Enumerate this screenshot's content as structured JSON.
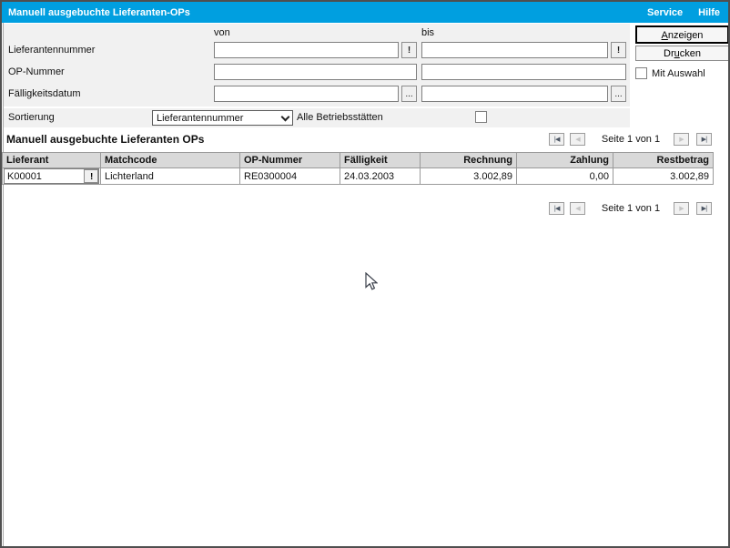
{
  "colors": {
    "titlebar": "#009FE0",
    "panel": "#f1f1f1",
    "table_header": "#d9d9d9",
    "window_border": "#4f4f4f"
  },
  "title_bar": {
    "title": "Manuell ausgebuchte Lieferanten-OPs",
    "service": "Service",
    "hilfe": "Hilfe"
  },
  "filter_panel": {
    "von_header": "von",
    "bis_header": "bis",
    "rows": {
      "lieferantennummer": {
        "label": "Lieferantennummer",
        "von_value": "",
        "bis_value": "",
        "lookup_label": "!"
      },
      "op_nummer": {
        "label": "OP-Nummer",
        "von_value": "",
        "bis_value": ""
      },
      "faelligkeitsdatum": {
        "label": "Fälligkeitsdatum",
        "von_value": "",
        "bis_value": "",
        "picker_label": "..."
      }
    }
  },
  "sortierung": {
    "label": "Sortierung",
    "selected": "Lieferantennummer",
    "alle_betriebsstaetten_label": "Alle Betriebsstätten",
    "alle_betriebsstaetten_checked": false
  },
  "actions": {
    "anzeigen_label": "Anzeigen",
    "anzeigen_accesskey": "A",
    "drucken_label": "Drucken",
    "drucken_accesskey": "u",
    "mit_auswahl_label": "Mit Auswahl",
    "mit_auswahl_checked": false
  },
  "section": {
    "title": "Manuell ausgebuchte Lieferanten OPs"
  },
  "pagination": {
    "page_text": "Seite 1 von 1",
    "first_label": "|◀",
    "prev_label": "◀",
    "next_label": "▶",
    "last_label": "▶|"
  },
  "table": {
    "columns": {
      "lieferant": "Lieferant",
      "matchcode": "Matchcode",
      "op_nummer": "OP-Nummer",
      "faelligkeit": "Fälligkeit",
      "rechnung": "Rechnung",
      "zahlung": "Zahlung",
      "restbetrag": "Restbetrag"
    },
    "rows": [
      {
        "lieferant": "K00001",
        "lookup_label": "!",
        "matchcode": "Lichterland",
        "op_nummer": "RE0300004",
        "faelligkeit": "24.03.2003",
        "rechnung": "3.002,89",
        "zahlung": "0,00",
        "restbetrag": "3.002,89"
      }
    ]
  }
}
